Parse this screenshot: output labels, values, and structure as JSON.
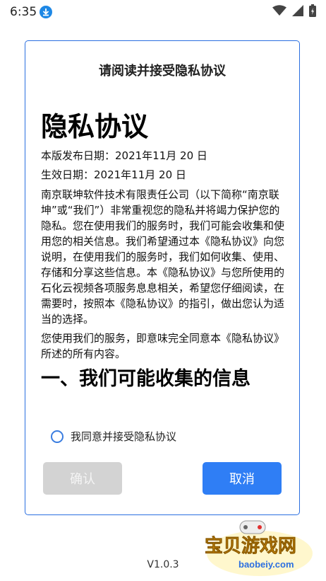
{
  "status_bar": {
    "time": "6:35"
  },
  "dialog": {
    "title": "请阅读并接受隐私协议",
    "doc_title": "隐私协议",
    "release_date": "本版发布日期：2021年11月 20 日",
    "effective_date": "生效日期：2021年11月 20 日",
    "paragraphs": [
      "南京联坤软件技术有限责任公司（以下简称“南京联坤”或“我们”）非常重视您的隐私并将竭力保护您的隐私。您在使用我们的服务时，我们可能会收集和使用您的相关信息。我们希望通过本《隐私协议》向您说明，在使用我们的服务时，我们如何收集、使用、存储和分享这些信息。本《隐私协议》与您所使用的石化云视频各项服务息息相关，希望您仔细阅读，在需要时，按照本《隐私协议》的指引，做出您认为适当的选择。",
      "您使用我们的服务，即意味完全同意本《隐私协议》所述的所有内容。"
    ],
    "section_heading": "一、我们可能收集的信息",
    "agree_label": "我同意并接受隐私协议",
    "confirm_label": "确认",
    "cancel_label": "取消"
  },
  "version": "V1.0.3",
  "watermark": {
    "text": "宝贝游戏网",
    "url": "baobeiy.com"
  }
}
